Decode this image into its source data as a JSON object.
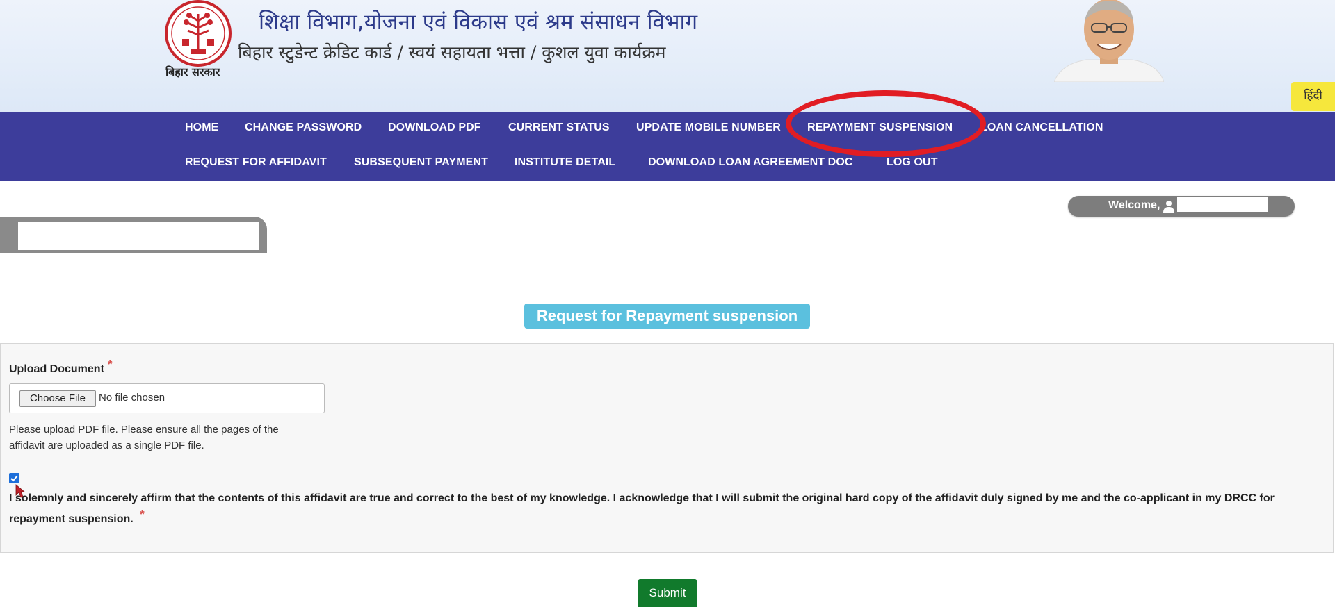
{
  "header": {
    "department_title": "शिक्षा विभाग,योजना एवं विकास एवं श्रम संसाधन विभाग",
    "program_subtitle": "बिहार स्टुडेन्ट क्रेडिट कार्ड / स्वयं सहायता भत्ता / कुशल युवा कार्यक्रम",
    "emblem_caption": "बिहार सरकार",
    "language_button": "हिंदी"
  },
  "nav": {
    "row1": [
      "HOME",
      "CHANGE PASSWORD",
      "DOWNLOAD PDF",
      "CURRENT STATUS",
      "UPDATE MOBILE NUMBER",
      "REPAYMENT SUSPENSION",
      "LOAN CANCELLATION"
    ],
    "row2": [
      "REQUEST FOR AFFIDAVIT",
      "SUBSEQUENT PAYMENT",
      "INSTITUTE DETAIL",
      "DOWNLOAD LOAN AGREEMENT DOC",
      "LOG OUT"
    ],
    "highlighted_item": "REPAYMENT SUSPENSION"
  },
  "welcome": {
    "label": "Welcome,"
  },
  "form": {
    "title": "Request for Repayment suspension",
    "upload_label": "Upload Document",
    "required_mark": "*",
    "choose_file_button": "Choose File",
    "no_file_text": "No file chosen",
    "help_line1": "Please upload PDF file. Please ensure all the pages of the",
    "help_line2": "affidavit are uploaded as a single PDF file.",
    "affirmation_checked": true,
    "affirmation_text": "I solemnly and sincerely affirm that the contents of this affidavit are true and correct to the best of my knowledge. I acknowledge that I will submit the original hard copy of the affidavit duly signed by me and the co-applicant in my DRCC for repayment suspension.",
    "submit_button": "Submit"
  },
  "colors": {
    "nav_bg": "#3d3d9b",
    "title_badge": "#5bc0de",
    "submit_bg": "#117a2c",
    "highlight_ring": "#e11d24",
    "lang_button_bg": "#f6e73c"
  },
  "icons": [
    "bihar-emblem-icon",
    "user-icon",
    "checkbox-checked-icon",
    "mouse-cursor-icon"
  ]
}
